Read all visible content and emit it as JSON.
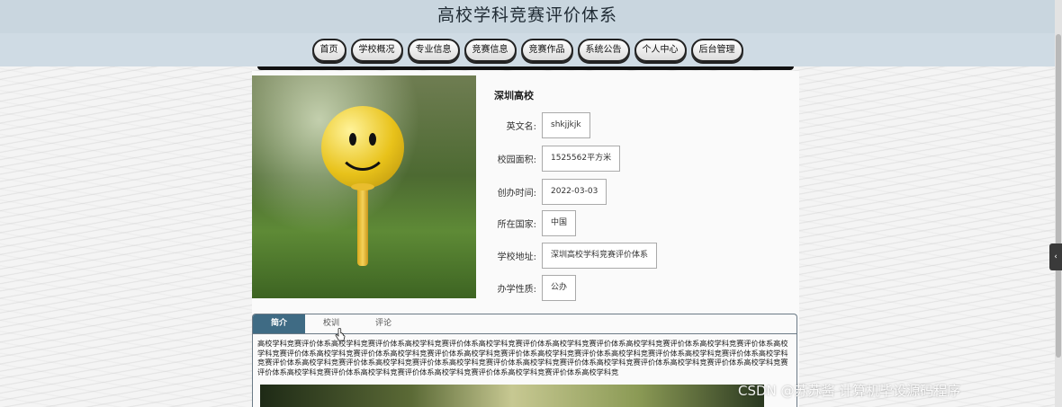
{
  "header": {
    "site_title": "高校学科竞赛评价体系"
  },
  "nav": {
    "items": [
      {
        "label": "首页"
      },
      {
        "label": "学校概况"
      },
      {
        "label": "专业信息"
      },
      {
        "label": "竞赛信息"
      },
      {
        "label": "竞赛作品"
      },
      {
        "label": "系统公告"
      },
      {
        "label": "个人中心"
      },
      {
        "label": "后台管理"
      }
    ]
  },
  "school": {
    "name": "深圳高校",
    "fields": [
      {
        "label": "英文名:",
        "value": "shkjjkjk"
      },
      {
        "label": "校园面积:",
        "value": "1525562平方米"
      },
      {
        "label": "创办时间:",
        "value": "2022-03-03"
      },
      {
        "label": "所在国家:",
        "value": "中国"
      },
      {
        "label": "学校地址:",
        "value": "深圳高校学科竞赛评价体系"
      },
      {
        "label": "办学性质:",
        "value": "公办"
      }
    ]
  },
  "tabs": {
    "items": [
      {
        "label": "简介",
        "active": true
      },
      {
        "label": "校训",
        "active": false
      },
      {
        "label": "评论",
        "active": false
      }
    ],
    "description": "高校学科竞赛评价体系高校学科竞赛评价体系高校学科竞赛评价体系高校学科竞赛评价体系高校学科竞赛评价体系高校学科竞赛评价体系高校学科竞赛评价体系高校学科竞赛评价体系高校学科竞赛评价体系高校学科竞赛评价体系高校学科竞赛评价体系高校学科竞赛评价体系高校学科竞赛评价体系高校学科竞赛评价体系高校学科竞赛评价体系高校学科竞赛评价体系高校学科竞赛评价体系高校学科竞赛评价体系高校学科竞赛评价体系高校学科竞赛评价体系高校学科竞赛评价体系高校学科竞赛评价体系高校学科竞赛评价体系高校学科竞赛评价体系高校学科竞赛评价体系高校学科竞赛评价体系高校学科竞"
  },
  "watermark": "CSDN @苏苏酱   计算机毕设源码程序",
  "icons": {
    "side_toggle": "chevron-left-icon",
    "cursor": "hand-pointer-icon"
  },
  "colors": {
    "active_tab": "#3f6b84",
    "header_bg": "#c9d6df"
  }
}
